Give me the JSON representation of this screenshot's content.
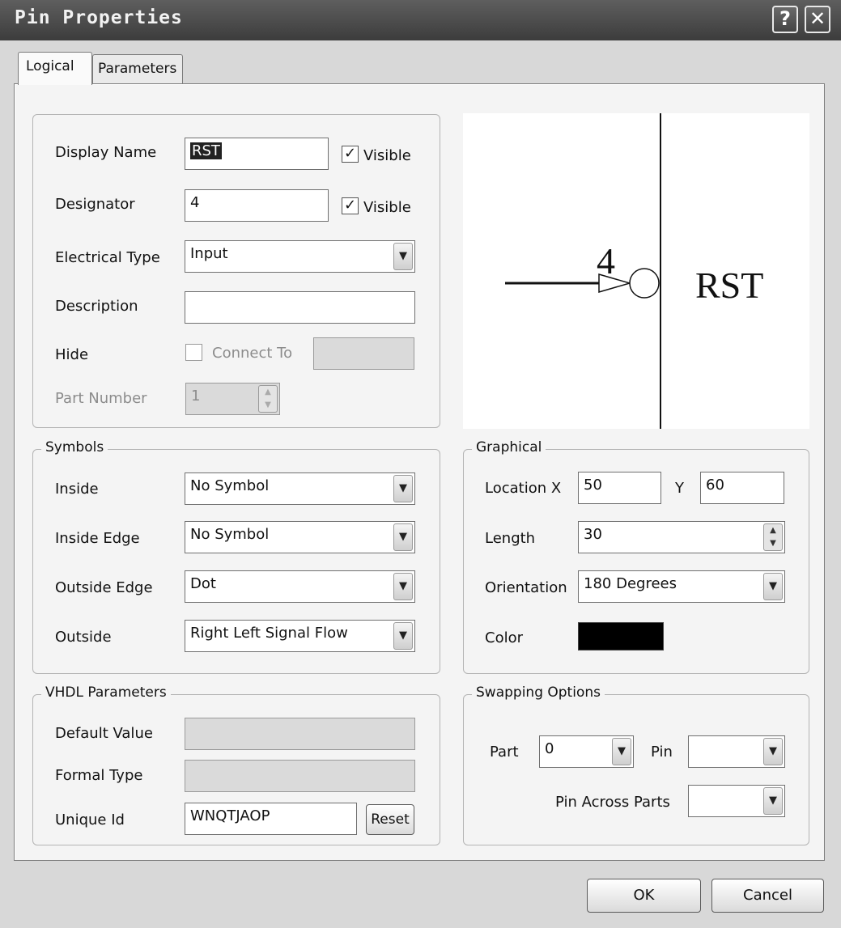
{
  "window": {
    "title": "Pin Properties",
    "help_label": "?",
    "close_label": "✕"
  },
  "tabs": [
    {
      "label": "Logical",
      "active": true
    },
    {
      "label": "Parameters",
      "active": false
    }
  ],
  "properties": {
    "display_name": {
      "label": "Display Name",
      "value": "RST",
      "visible_label": "Visible",
      "visible_checked": true
    },
    "designator": {
      "label": "Designator",
      "value": "4",
      "visible_label": "Visible",
      "visible_checked": true
    },
    "electrical_type": {
      "label": "Electrical Type",
      "value": "Input"
    },
    "description": {
      "label": "Description",
      "value": ""
    },
    "hide": {
      "label": "Hide",
      "connect_to_label": "Connect To",
      "connect_to_value": ""
    },
    "part_number": {
      "label": "Part Number",
      "value": "1"
    }
  },
  "preview": {
    "designator": "4",
    "name": "RST"
  },
  "symbols": {
    "legend": "Symbols",
    "inside": {
      "label": "Inside",
      "value": "No Symbol"
    },
    "inside_edge": {
      "label": "Inside Edge",
      "value": "No Symbol"
    },
    "outside_edge": {
      "label": "Outside Edge",
      "value": "Dot"
    },
    "outside": {
      "label": "Outside",
      "value": "Right Left Signal Flow"
    }
  },
  "graphical": {
    "legend": "Graphical",
    "location_label": "Location X",
    "x_value": "50",
    "y_label": "Y",
    "y_value": "60",
    "length_label": "Length",
    "length_value": "30",
    "orientation_label": "Orientation",
    "orientation_value": "180 Degrees",
    "color_label": "Color",
    "color_value": "#000000"
  },
  "vhdl": {
    "legend": "VHDL Parameters",
    "default_value_label": "Default Value",
    "default_value": "",
    "formal_type_label": "Formal Type",
    "formal_type": "",
    "unique_id_label": "Unique Id",
    "unique_id": "WNQTJAOP",
    "reset_label": "Reset"
  },
  "swapping": {
    "legend": "Swapping Options",
    "part_label": "Part",
    "part_value": "0",
    "pin_label": "Pin",
    "pin_value": "",
    "pin_across_label": "Pin Across Parts",
    "pin_across_value": ""
  },
  "footer": {
    "ok_label": "OK",
    "cancel_label": "Cancel"
  },
  "icons": {
    "dropdown": "chevron-down-icon",
    "check": "checkmark-icon"
  }
}
